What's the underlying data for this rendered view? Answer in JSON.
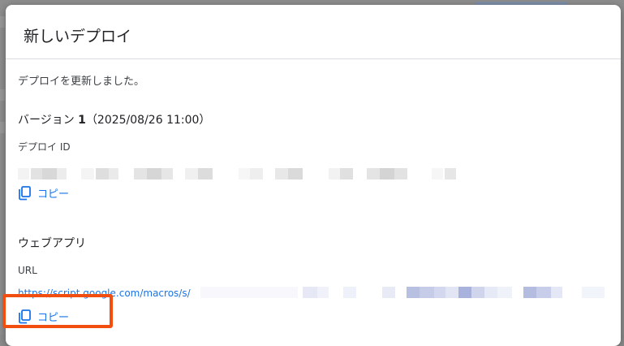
{
  "dialog": {
    "title": "新しいデプロイ",
    "status_message": "デプロイを更新しました。",
    "version": {
      "prefix": "バージョン ",
      "number": "1",
      "timestamp": "（2025/08/26 11:00）"
    },
    "deploy_id": {
      "label": "デプロイ ID",
      "copy_label": "コピー"
    },
    "web_app": {
      "heading": "ウェブアプリ",
      "url_label": "URL",
      "url_visible": "https://script.google.com/macros/s/",
      "copy_label": "コピー"
    }
  },
  "colors": {
    "accent": "#1a73e8",
    "highlight": "#f24e0f"
  },
  "icons": {
    "copy": "copy-icon"
  }
}
